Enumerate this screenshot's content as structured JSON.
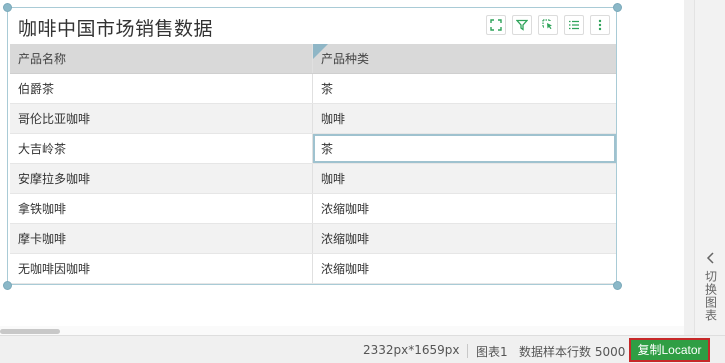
{
  "widget": {
    "title": "咖啡中国市场销售数据",
    "toolbar_icons": [
      "fullscreen-icon",
      "filter-icon",
      "select-icon",
      "list-icon",
      "more-icon"
    ]
  },
  "table": {
    "columns": [
      "产品名称",
      "产品种类"
    ],
    "rows": [
      [
        "伯爵茶",
        "茶"
      ],
      [
        "哥伦比亚咖啡",
        "咖啡"
      ],
      [
        "大吉岭茶",
        "茶"
      ],
      [
        "安摩拉多咖啡",
        "咖啡"
      ],
      [
        "拿铁咖啡",
        "浓缩咖啡"
      ],
      [
        "摩卡咖啡",
        "浓缩咖啡"
      ],
      [
        "无咖啡因咖啡",
        "浓缩咖啡"
      ]
    ]
  },
  "side_panel": {
    "toggle_label": "切换图表"
  },
  "statusbar": {
    "dimensions": "2332px*1659px",
    "chart_name": "图表1",
    "sample_rows": "数据样本行数 5000",
    "copy_locator_label": "复制Locator"
  },
  "colors": {
    "copy_button_bg": "#2f9e44",
    "copy_button_border": "#c62828",
    "header_bg": "#d9d9d9",
    "widget_border": "#a9cbd6"
  }
}
